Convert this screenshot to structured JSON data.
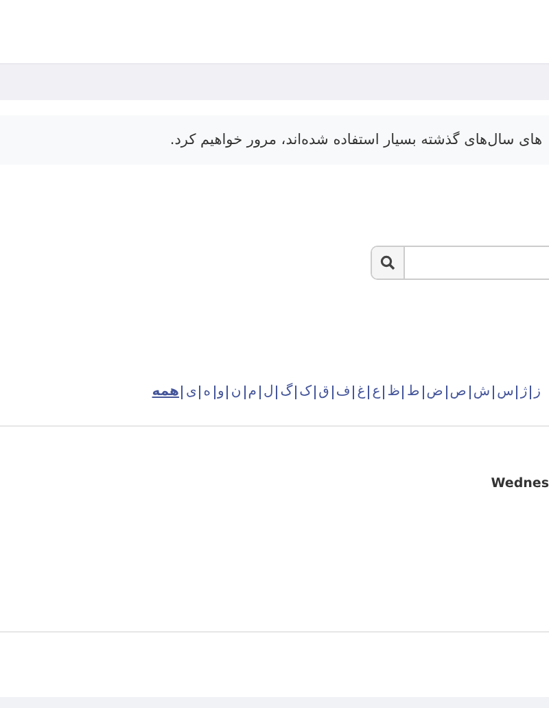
{
  "notice": {
    "text": "های سال‌های گذشته بسیار استفاده شده‌اند، مرور خواهیم کرد."
  },
  "letters": [
    {
      "label": "ز",
      "selected": false
    },
    {
      "label": "ژ",
      "selected": false
    },
    {
      "label": "س",
      "selected": false
    },
    {
      "label": "ش",
      "selected": false
    },
    {
      "label": "ص",
      "selected": false
    },
    {
      "label": "ض",
      "selected": false
    },
    {
      "label": "ط",
      "selected": false
    },
    {
      "label": "ظ",
      "selected": false
    },
    {
      "label": "ع",
      "selected": false
    },
    {
      "label": "غ",
      "selected": false
    },
    {
      "label": "ف",
      "selected": false
    },
    {
      "label": "ق",
      "selected": false
    },
    {
      "label": "ک",
      "selected": false
    },
    {
      "label": "گ",
      "selected": false
    },
    {
      "label": "ل",
      "selected": false
    },
    {
      "label": "م",
      "selected": false
    },
    {
      "label": "ن",
      "selected": false
    },
    {
      "label": "و",
      "selected": false
    },
    {
      "label": "ه",
      "selected": false
    },
    {
      "label": "ی",
      "selected": false
    },
    {
      "label": "همه",
      "selected": true
    }
  ],
  "day_heading": "Wednes"
}
